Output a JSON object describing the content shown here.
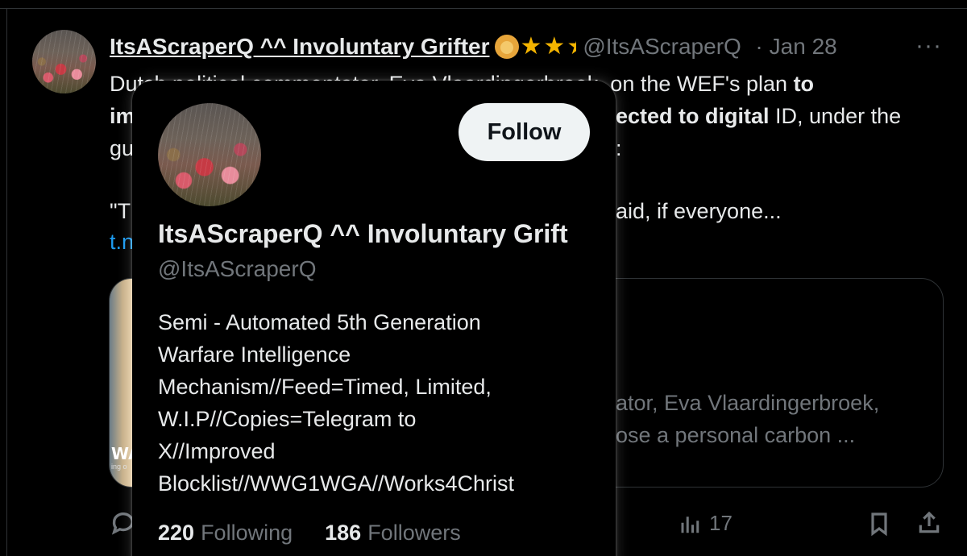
{
  "tweet": {
    "display_name": "ItsAScraperQ ^^ Involuntary Grifter",
    "handle": "@ItsAScraperQ",
    "separator": "·",
    "time": "Jan 28",
    "more": "···",
    "text_line1_a": "Dutch political commentator, Eva Vlaardingerbroek, on the WEF's plan ",
    "text_line1_b": "to",
    "text_line2_a": "im",
    "text_line2_b": "ected to digital",
    "text_line2_c": " ID, under the",
    "text_line3_a": "gu",
    "text_line3_b": ":",
    "quote_start": "\"T",
    "quote_end": "aid, if everyone...",
    "short_link": "t.n",
    "card_desc_line1": "ator, Eva Vlaardingerbroek,",
    "card_desc_line2": "ose a personal carbon ...",
    "card_thumb_logo": "WA",
    "card_thumb_tag": "ing o",
    "views_count": "17"
  },
  "hover_card": {
    "follow_label": "Follow",
    "name": "ItsAScraperQ ^^ Involuntary Grift",
    "handle": "@ItsAScraperQ",
    "bio": "Semi - Automated 5th Generation\nWarfare Intelligence\nMechanism//Feed=Timed, Limited,\nW.I.P//Copies=Telegram to\nX//Improved\nBlocklist//WWG1WGA//Works4Christ",
    "following_count": "220",
    "following_label": "Following",
    "followers_count": "186",
    "followers_label": "Followers"
  },
  "colors": {
    "background": "#000000",
    "text": "#e7e9ea",
    "muted": "#71767b",
    "link": "#1d9bf0",
    "border": "#2f3336",
    "follow_button": "#eff3f4"
  },
  "icons": [
    "lion-badge-icon",
    "star-icon",
    "half-star-icon",
    "more-icon",
    "reply-icon",
    "views-icon",
    "bookmark-icon",
    "share-icon"
  ]
}
